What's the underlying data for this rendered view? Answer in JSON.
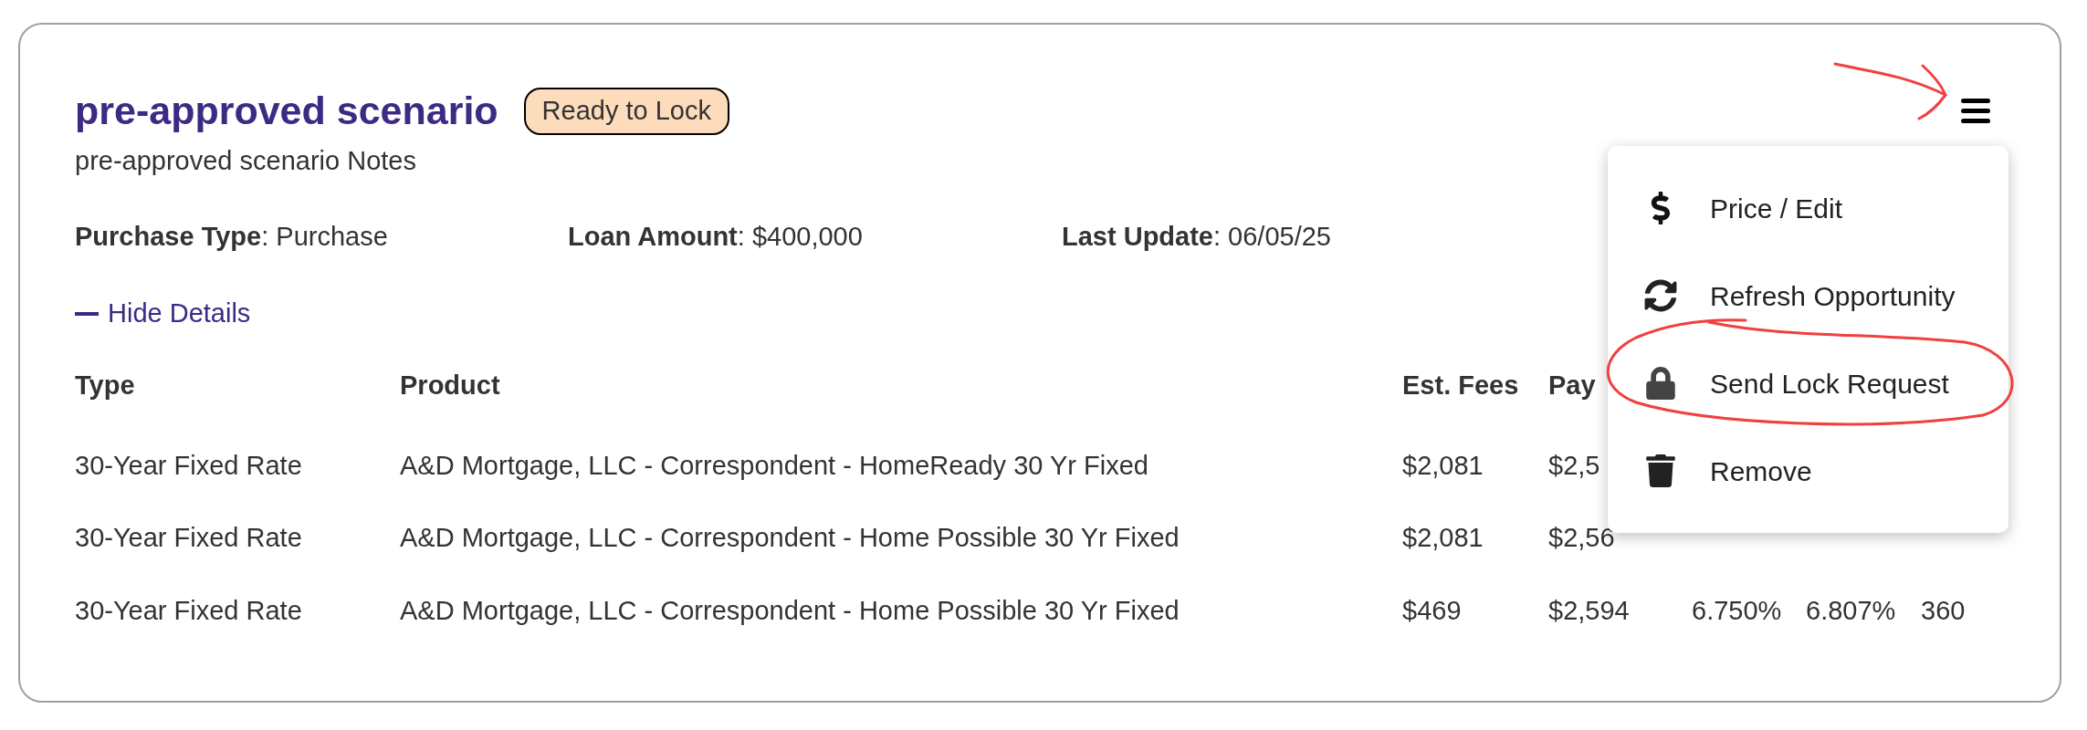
{
  "card": {
    "title": "pre-approved scenario",
    "badge": "Ready to Lock",
    "notes": "pre-approved scenario Notes",
    "summary": [
      "**Purchase Type**: Purchase",
      "**Loan Amount**: $400,000",
      "**Last Update**: 06/05/25"
    ],
    "details_toggle": {
      "label": "Hide Details",
      "expanded": true
    },
    "table": {
      "columns": [
        "Type",
        "Product",
        "Est. Fees",
        "Pay"
      ],
      "rows": [
        [
          "30-Year Fixed Rate",
          "A&D Mortgage, LLC - Correspondent - HomeReady 30 Yr Fixed",
          "$2,081",
          "$2,5"
        ],
        [
          "30-Year Fixed Rate",
          "A&D Mortgage, LLC - Correspondent - Home Possible 30 Yr Fixed",
          "$2,081",
          "$2,56"
        ],
        [
          "30-Year Fixed Rate",
          "A&D Mortgage, LLC - Correspondent - Home Possible 30 Yr Fixed",
          "$469",
          "$2,594",
          "6.750%",
          "6.807%",
          "360"
        ]
      ]
    }
  },
  "menu": {
    "open": true,
    "items": [
      {
        "label": "Price / Edit"
      },
      {
        "label": "Refresh Opportunity"
      },
      {
        "label": "Send Lock Request"
      },
      {
        "label": "Remove"
      }
    ]
  }
}
